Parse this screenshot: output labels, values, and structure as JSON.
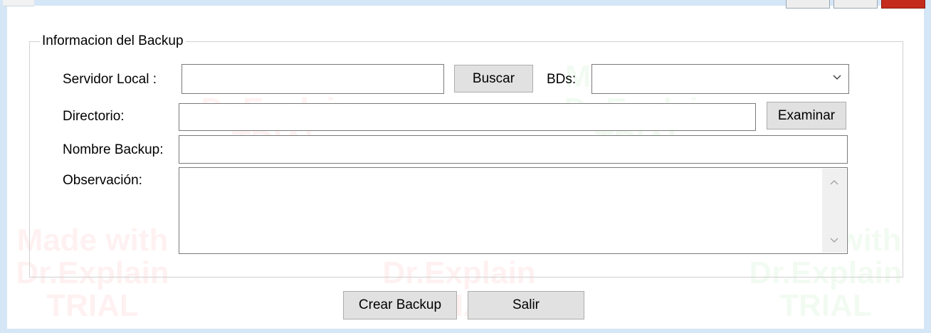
{
  "group": {
    "title": "Informacion del Backup"
  },
  "fields": {
    "servidor_label": "Servidor Local :",
    "servidor_value": "",
    "buscar_label": "Buscar",
    "bds_label": "BDs:",
    "bds_selected": "",
    "directorio_label": "Directorio:",
    "directorio_value": "",
    "examinar_label": "Examinar",
    "nombre_label": "Nombre Backup:",
    "nombre_value": "",
    "observacion_label": "Observación:",
    "observacion_value": ""
  },
  "actions": {
    "crear_label": "Crear Backup",
    "salir_label": "Salir"
  },
  "watermark": {
    "text": "Made with\nDr.Explain\nTRIAL"
  },
  "colors": {
    "window_border": "#d5e6f7",
    "button_face": "#e1e1e1",
    "close_button": "#c42b1c"
  }
}
